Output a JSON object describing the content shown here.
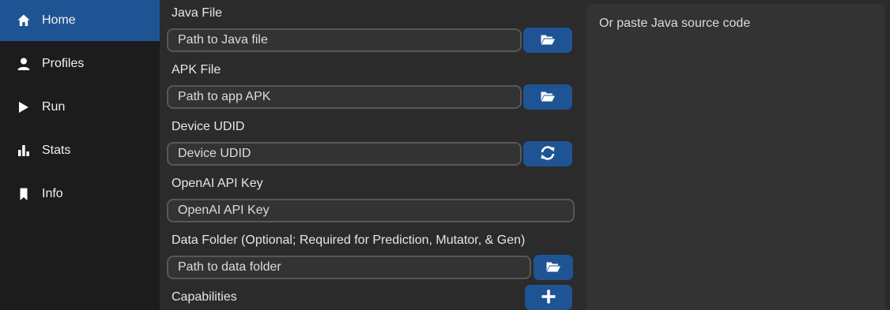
{
  "sidebar": {
    "items": [
      {
        "label": "Home",
        "icon": "home-icon",
        "active": true
      },
      {
        "label": "Profiles",
        "icon": "person-icon",
        "active": false
      },
      {
        "label": "Run",
        "icon": "play-icon",
        "active": false
      },
      {
        "label": "Stats",
        "icon": "bar-chart-icon",
        "active": false
      },
      {
        "label": "Info",
        "icon": "bookmark-icon",
        "active": false
      }
    ]
  },
  "form": {
    "java_file": {
      "label": "Java File",
      "placeholder": "Path to Java file"
    },
    "apk_file": {
      "label": "APK File",
      "placeholder": "Path to app APK"
    },
    "device_udid": {
      "label": "Device UDID",
      "placeholder": "Device UDID"
    },
    "openai_key": {
      "label": "OpenAI API Key",
      "placeholder": "OpenAI API Key"
    },
    "data_folder": {
      "label": "Data Folder (Optional; Required for Prediction, Mutator, & Gen)",
      "placeholder": "Path to data folder"
    },
    "capabilities": {
      "label": "Capabilities"
    }
  },
  "source_panel": {
    "placeholder": "Or paste Java source code"
  },
  "colors": {
    "accent": "#1f5494",
    "sidebar_bg": "#1c1c1c",
    "main_bg": "#2b2b2b",
    "input_bg": "#333333"
  }
}
